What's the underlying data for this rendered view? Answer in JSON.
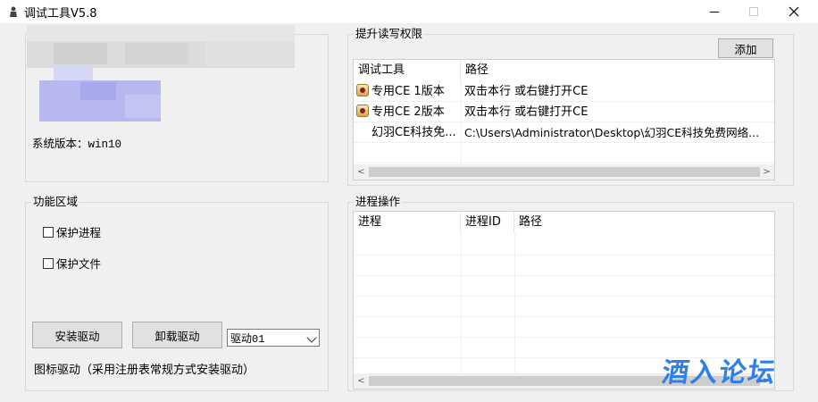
{
  "window": {
    "title": "调试工具V5.8",
    "minimize_label": "",
    "close_glyph": "✕"
  },
  "sysinfo": {
    "version_label": "系统版本：",
    "version_value": "win10"
  },
  "privilege": {
    "group_title": "提升读写权限",
    "add_button": "添加",
    "columns": [
      "调试工具",
      "路径"
    ],
    "rows": [
      {
        "icon": "ce-icon",
        "tool": "专用CE 1版本",
        "path": "双击本行 或右键打开CE"
      },
      {
        "icon": "ce-icon",
        "tool": "专用CE 2版本",
        "path": "双击本行 或右键打开CE"
      },
      {
        "icon": "",
        "tool": "幻羽CE科技免...",
        "path": "C:\\Users\\Administrator\\Desktop\\幻羽CE科技免费网络..."
      }
    ],
    "scroll_left": "<",
    "scroll_right": ">"
  },
  "functions": {
    "group_title": "功能区域",
    "protect_process": "保护进程",
    "protect_file": "保护文件",
    "install_button": "安装驱动",
    "uninstall_button": "卸载驱动",
    "driver_select": "驱动01",
    "note": "图标驱动（采用注册表常规方式安装驱动）"
  },
  "process": {
    "group_title": "进程操作",
    "columns": [
      "进程",
      "进程ID",
      "路径"
    ],
    "scroll_left": "<",
    "scroll_right": ">"
  },
  "watermark": "酒入论坛",
  "colors": {
    "accent_blue": "#2e7fe8",
    "mosaic_purple": "#b8b8f0"
  }
}
